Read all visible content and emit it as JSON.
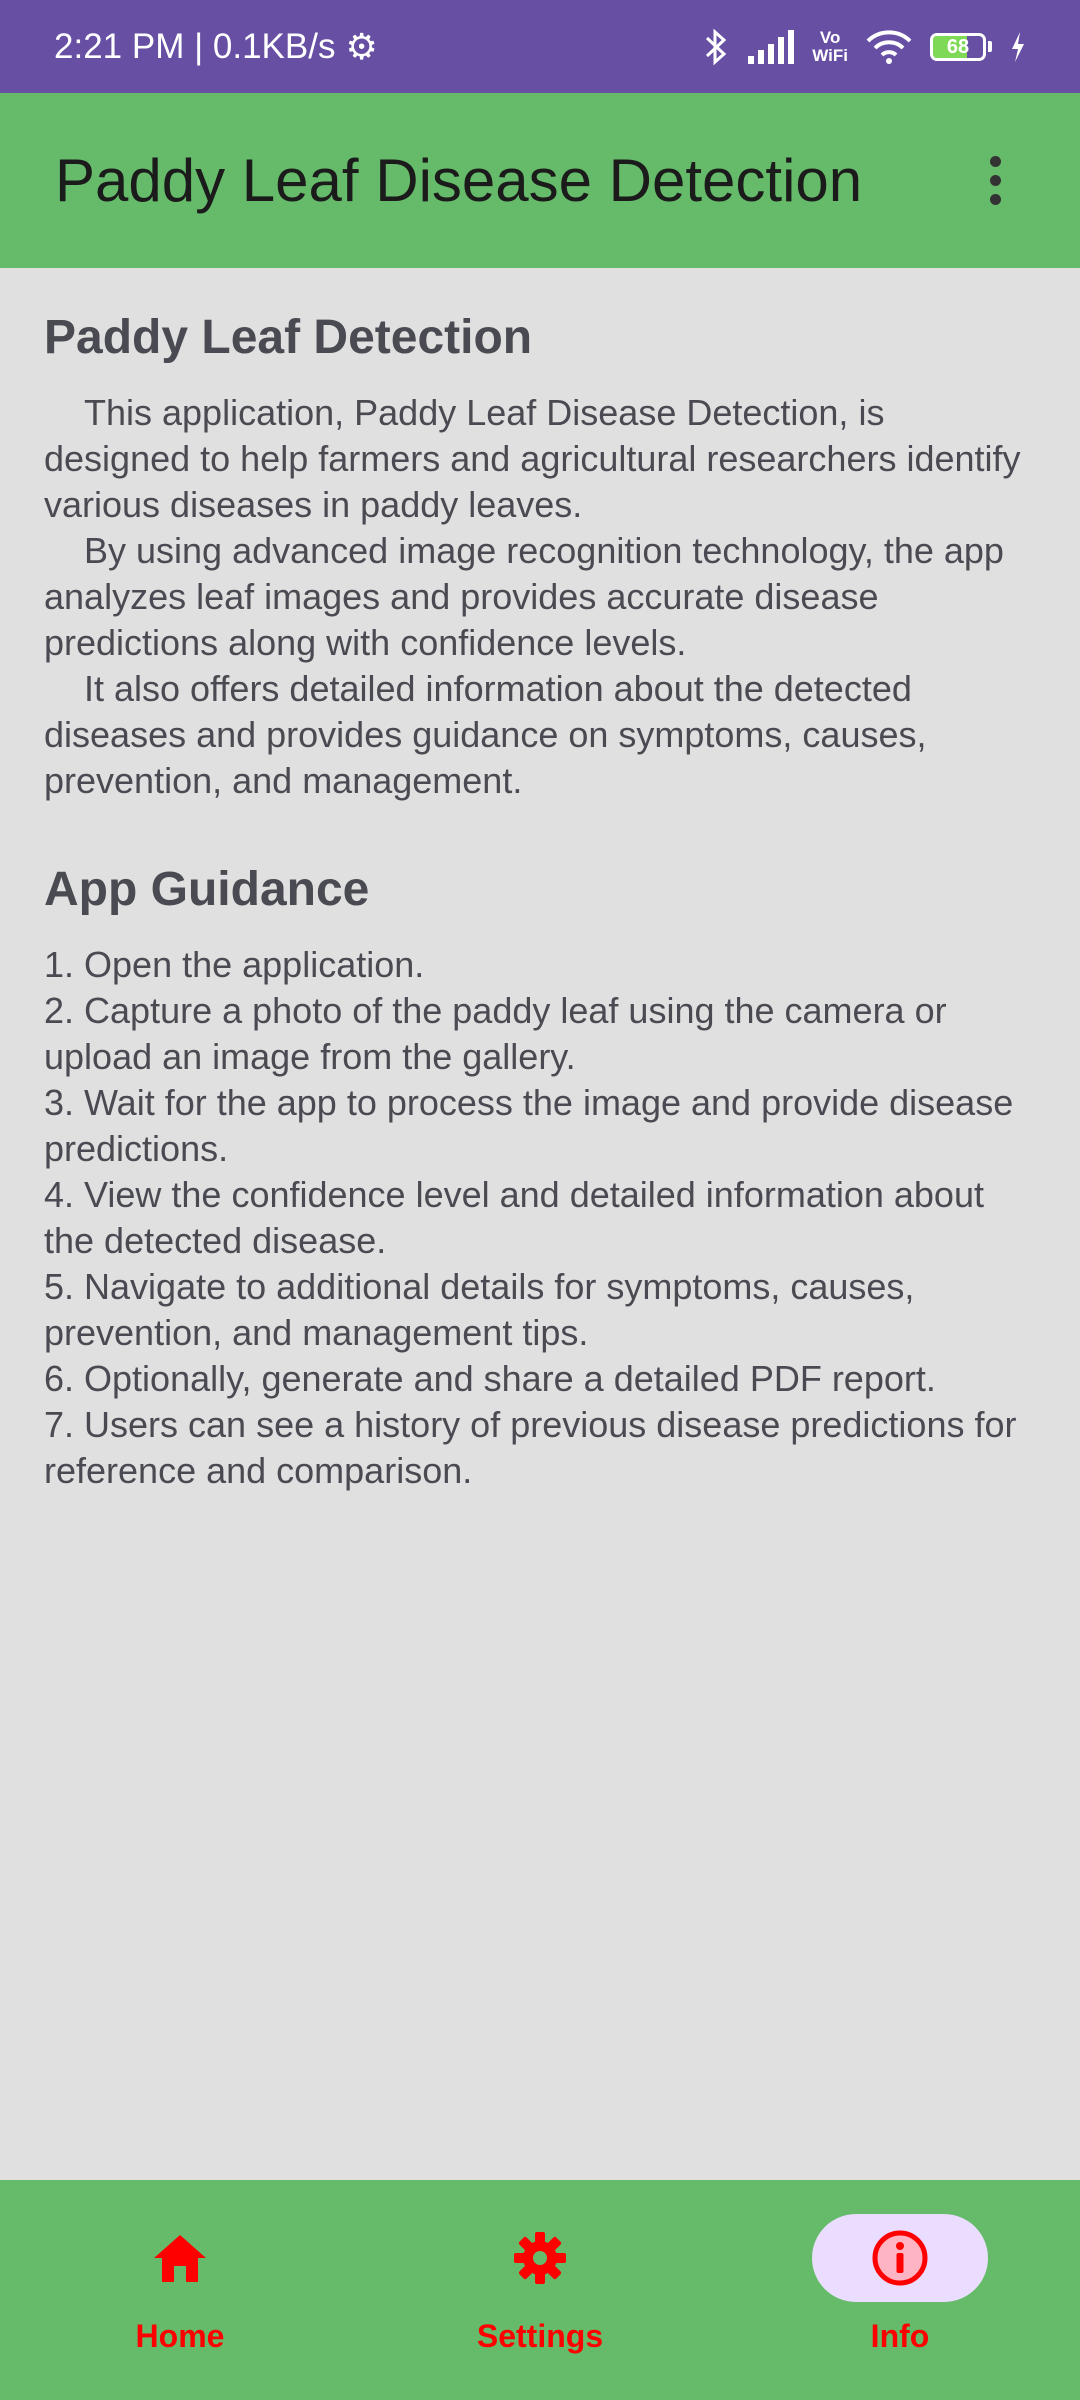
{
  "status_bar": {
    "time_speed": "2:21 PM | 0.1KB/s",
    "vowifi_top": "Vo",
    "vowifi_bottom": "WiFi",
    "battery_level": "68"
  },
  "app_bar": {
    "title": "Paddy Leaf Disease Detection"
  },
  "content": {
    "section1_title": "Paddy Leaf Detection",
    "paragraphs": [
      "This application, Paddy Leaf Disease Detection, is designed to help farmers and agricultural researchers identify various diseases in paddy leaves.",
      "By using advanced image recognition technology, the app analyzes leaf images and provides accurate disease predictions along with confidence levels.",
      "It also offers detailed information about the detected diseases and provides guidance on symptoms, causes, prevention, and management."
    ],
    "section2_title": "App Guidance",
    "steps": [
      "1. Open the application.",
      "2. Capture a photo of the paddy leaf using the camera or upload an image from the gallery.",
      "3. Wait for the app to process the image and provide disease predictions.",
      "4. View the confidence level and detailed information about the detected disease.",
      "5. Navigate to additional details for symptoms, causes, prevention, and management tips.",
      "6. Optionally, generate and share a detailed PDF report.",
      "7. Users can see a history of previous disease predictions for reference and comparison."
    ]
  },
  "bottom_nav": {
    "items": [
      {
        "label": "Home",
        "icon": "home-icon"
      },
      {
        "label": "Settings",
        "icon": "settings-icon"
      },
      {
        "label": "Info",
        "icon": "info-icon",
        "selected": true
      }
    ]
  },
  "colors": {
    "status_bar": "#6750a4",
    "app_bar": "#66bb6a",
    "background": "#e0e0e0",
    "nav_accent": "#ff0000",
    "active_pill": "#eaddff"
  }
}
